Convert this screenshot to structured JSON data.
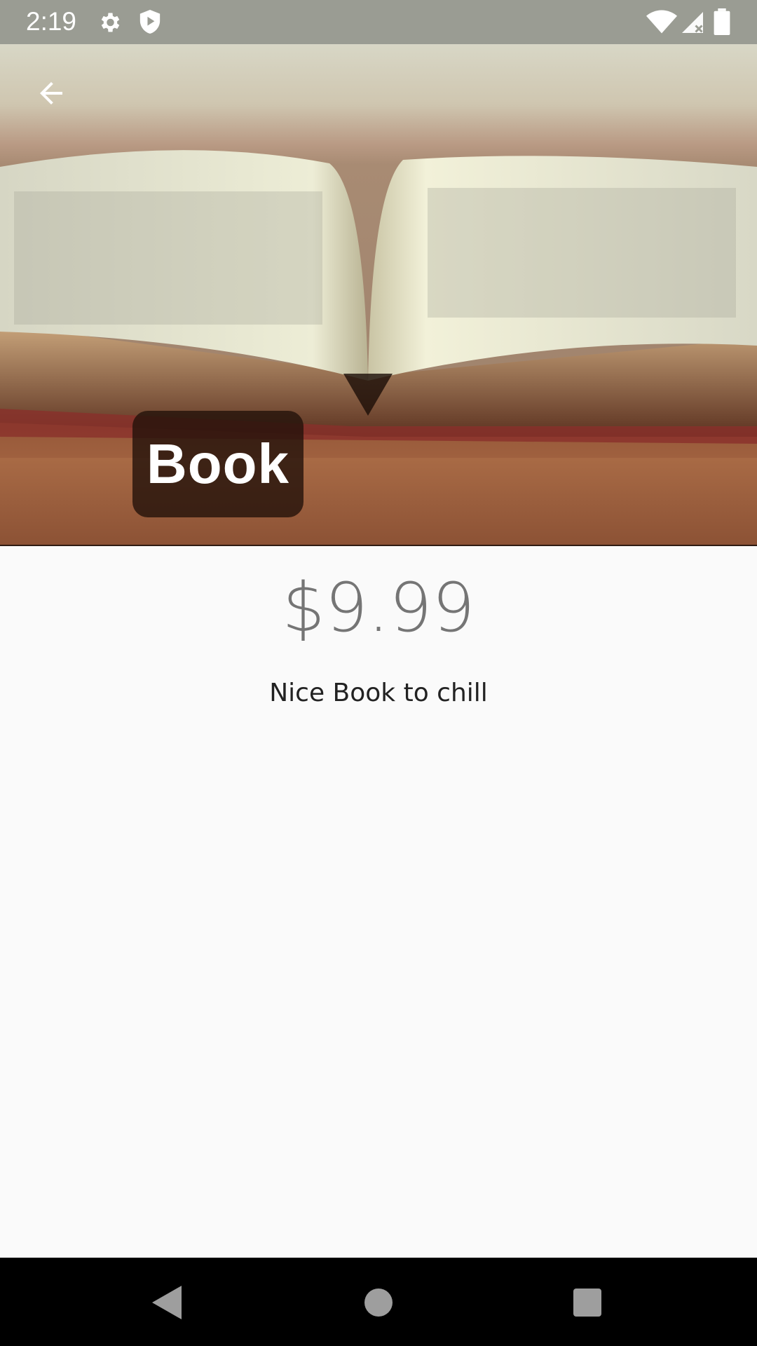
{
  "status_bar": {
    "time": "2:19",
    "icons": [
      "gear-icon",
      "shield-play-icon",
      "wifi-icon",
      "signal-icon",
      "battery-icon"
    ]
  },
  "header": {
    "back_icon": "arrow-left-icon",
    "title": "Book"
  },
  "product": {
    "price": "$9.99",
    "description": "Nice Book to chill"
  },
  "nav_bar": {
    "icons": [
      "back-triangle-icon",
      "home-circle-icon",
      "recents-square-icon"
    ]
  },
  "colors": {
    "status_bar": "#9a9c93",
    "background": "#fafafa",
    "price_text": "#757575",
    "title_chip": "#23120a"
  }
}
